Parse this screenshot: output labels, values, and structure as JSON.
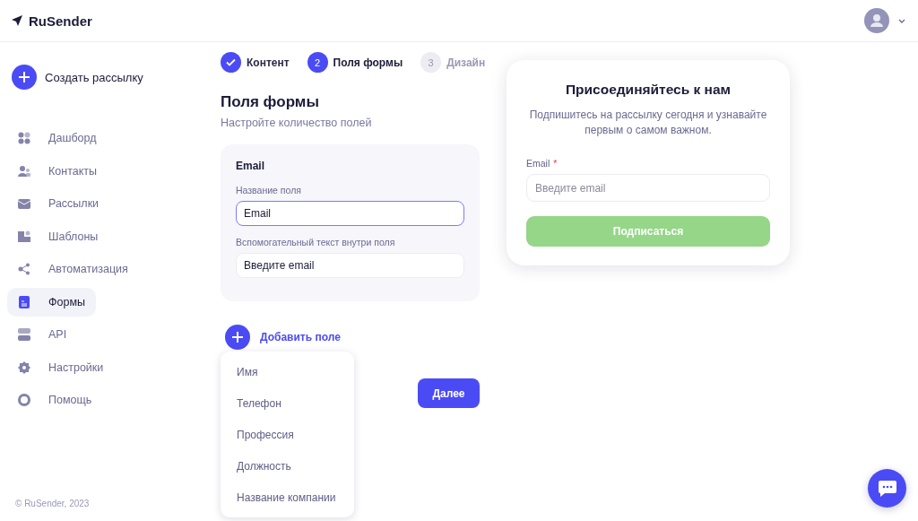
{
  "brand": {
    "name": "RuSender"
  },
  "sidebar": {
    "create_button": "Создать рассылку",
    "items": [
      {
        "label": "Дашборд",
        "selected": false
      },
      {
        "label": "Контакты",
        "selected": false
      },
      {
        "label": "Рассылки",
        "selected": false
      },
      {
        "label": "Шаблоны",
        "selected": false
      },
      {
        "label": "Автоматизация",
        "selected": false
      },
      {
        "label": "Формы",
        "selected": true
      },
      {
        "label": "API",
        "selected": false
      },
      {
        "label": "Настройки",
        "selected": false
      },
      {
        "label": "Помощь",
        "selected": false
      }
    ],
    "footer": "© RuSender, 2023"
  },
  "steps": [
    {
      "label": "Контент",
      "done": true,
      "selected": false
    },
    {
      "number": "2",
      "label": "Поля формы",
      "done": false,
      "selected": true
    },
    {
      "number": "3",
      "label": "Дизайн",
      "done": false,
      "selected": false
    }
  ],
  "section": {
    "title": "Поля формы",
    "subtitle": "Настройте количество полей"
  },
  "field_card": {
    "title": "Email",
    "inputs": [
      {
        "label": "Название поля",
        "value": "Email",
        "focused": true
      },
      {
        "label": "Вспомогательный текст внутри поля",
        "value": "Введите email",
        "focused": false
      }
    ]
  },
  "add_field": {
    "label": "Добавить поле",
    "menu": [
      "Имя",
      "Телефон",
      "Профессия",
      "Должность",
      "Название компании"
    ]
  },
  "next_button": "Далее",
  "preview": {
    "title": "Присоединяйтесь к нам",
    "text": "Подпишитесь на рассылку сегодня и узнавайте первым о самом важном.",
    "email_label": "Email",
    "required_mark": "*",
    "email_placeholder": "Введите email",
    "submit": "Подписаться"
  }
}
